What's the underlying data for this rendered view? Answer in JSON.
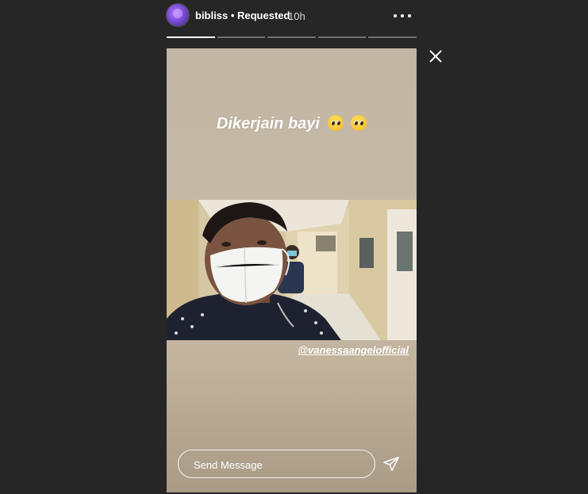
{
  "header": {
    "username": "bibliss",
    "separator": "•",
    "follow_status": "Requested",
    "time_ago": "10h"
  },
  "progress": {
    "segments": 5,
    "current_index": 0,
    "current_fraction": 1.0
  },
  "story": {
    "caption_text": "Dikerjain bayi",
    "caption_emojis": [
      "pleading-face",
      "pleading-face"
    ],
    "mention": "@vanessaangelofficial"
  },
  "reply": {
    "placeholder": "Send Message"
  },
  "colors": {
    "background": "#262626",
    "story_bg": "#c4b8a5",
    "text": "#ffffff"
  }
}
